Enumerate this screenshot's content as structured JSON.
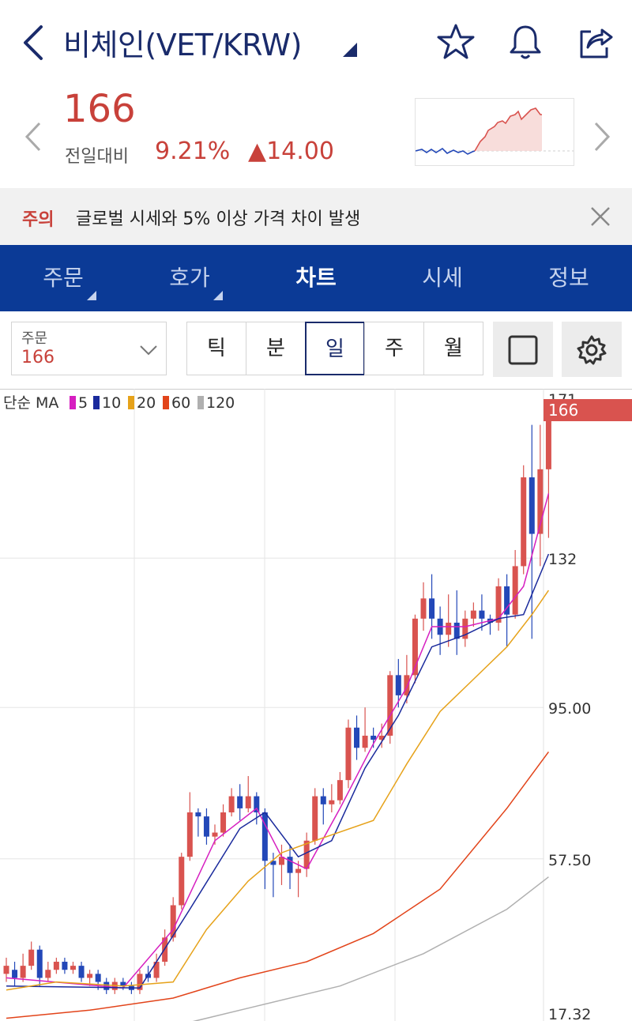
{
  "header": {
    "title": "비체인(VET/KRW)",
    "icons": [
      "back-icon",
      "caret-down-icon",
      "star-icon",
      "bell-icon",
      "share-icon"
    ]
  },
  "price": {
    "value": "166",
    "change_label": "전일대비",
    "change_pct": "9.21%",
    "change_abs": "▲14.00",
    "up_color": "#c8413a"
  },
  "alert": {
    "tag": "주의",
    "message": "글로벌 시세와 5% 이상 가격 차이 발생"
  },
  "tabs": [
    {
      "label": "주문",
      "active": false,
      "has_menu": true
    },
    {
      "label": "호가",
      "active": false,
      "has_menu": true
    },
    {
      "label": "차트",
      "active": true,
      "has_menu": false
    },
    {
      "label": "시세",
      "active": false,
      "has_menu": false
    },
    {
      "label": "정보",
      "active": false,
      "has_menu": false
    }
  ],
  "toolbar": {
    "order_label": "주문",
    "order_value": "166",
    "intervals": [
      {
        "label": "틱",
        "active": false
      },
      {
        "label": "분",
        "active": false
      },
      {
        "label": "일",
        "active": true
      },
      {
        "label": "주",
        "active": false
      },
      {
        "label": "월",
        "active": false
      }
    ]
  },
  "theme": {
    "navy": "#0b3a96",
    "title_navy": "#1a2b6b",
    "up": "#d9534f",
    "down": "#2348b8"
  },
  "chart_data": {
    "type": "candlestick",
    "legend_prefix": "단순 MA",
    "legend": [
      {
        "name": "5",
        "color": "#d61fc0"
      },
      {
        "name": "10",
        "color": "#1a2a9c"
      },
      {
        "name": "20",
        "color": "#e6a21a"
      },
      {
        "name": "60",
        "color": "#e2441a"
      },
      {
        "name": "120",
        "color": "#b0b0b0"
      }
    ],
    "y_ticks": [
      "171",
      "132",
      "95.00",
      "57.50",
      "17.32"
    ],
    "ylim": [
      17.32,
      171
    ],
    "current_price_label": "166",
    "candles": [
      [
        29,
        31,
        27,
        33
      ],
      [
        30,
        28,
        26,
        32
      ],
      [
        28,
        31,
        27,
        34
      ],
      [
        31,
        35,
        30,
        37
      ],
      [
        35,
        28,
        26,
        36
      ],
      [
        28,
        30,
        27,
        32
      ],
      [
        30,
        32,
        29,
        33
      ],
      [
        32,
        30,
        29,
        33
      ],
      [
        30,
        31,
        29,
        32
      ],
      [
        31,
        28,
        27,
        32
      ],
      [
        28,
        29,
        26,
        30
      ],
      [
        29,
        27,
        25,
        30
      ],
      [
        27,
        25,
        24,
        28
      ],
      [
        25,
        27,
        24,
        28
      ],
      [
        27,
        26,
        25,
        28
      ],
      [
        26,
        25,
        24,
        27
      ],
      [
        25,
        29,
        24,
        30
      ],
      [
        29,
        28,
        27,
        31
      ],
      [
        28,
        32,
        27,
        34
      ],
      [
        32,
        38,
        31,
        40
      ],
      [
        38,
        46,
        37,
        48
      ],
      [
        46,
        58,
        45,
        59
      ],
      [
        58,
        69,
        57,
        74
      ],
      [
        69,
        68,
        63,
        70
      ],
      [
        68,
        63,
        61,
        70
      ],
      [
        63,
        64,
        61,
        66
      ],
      [
        64,
        69,
        63,
        71
      ],
      [
        69,
        73,
        68,
        75
      ],
      [
        73,
        70,
        67,
        76
      ],
      [
        70,
        73,
        69,
        78
      ],
      [
        73,
        69,
        66,
        74
      ],
      [
        69,
        57,
        50,
        70
      ],
      [
        57,
        56,
        48,
        59
      ],
      [
        56,
        58,
        51,
        61
      ],
      [
        58,
        54,
        50,
        61
      ],
      [
        54,
        55,
        48,
        57
      ],
      [
        55,
        62,
        53,
        64
      ],
      [
        62,
        73,
        61,
        75
      ],
      [
        73,
        71,
        66,
        75
      ],
      [
        71,
        72,
        69,
        76
      ],
      [
        72,
        77,
        71,
        79
      ],
      [
        77,
        90,
        75,
        92
      ],
      [
        90,
        85,
        82,
        93
      ],
      [
        85,
        88,
        84,
        95
      ],
      [
        88,
        87,
        85,
        90
      ],
      [
        87,
        88,
        85,
        91
      ],
      [
        88,
        103,
        86,
        104
      ],
      [
        103,
        98,
        95,
        107
      ],
      [
        98,
        103,
        96,
        108
      ],
      [
        103,
        117,
        101,
        118
      ],
      [
        117,
        122,
        114,
        126
      ],
      [
        122,
        117,
        112,
        128
      ],
      [
        117,
        113,
        108,
        120
      ],
      [
        113,
        116,
        110,
        123
      ],
      [
        116,
        112,
        108,
        124
      ],
      [
        112,
        117,
        110,
        119
      ],
      [
        117,
        119,
        115,
        121
      ],
      [
        119,
        117,
        114,
        123
      ],
      [
        117,
        116,
        113,
        118
      ],
      [
        116,
        125,
        114,
        127
      ],
      [
        125,
        118,
        110,
        128
      ],
      [
        118,
        130,
        117,
        134
      ],
      [
        130,
        152,
        128,
        155
      ],
      [
        152,
        138,
        112,
        165
      ],
      [
        138,
        154,
        130,
        165
      ],
      [
        154,
        166,
        137,
        171
      ]
    ],
    "ma": {
      "5": [
        [
          0,
          28
        ],
        [
          14,
          25.5
        ],
        [
          20,
          40
        ],
        [
          25,
          62
        ],
        [
          30,
          70
        ],
        [
          33,
          58
        ],
        [
          36,
          55
        ],
        [
          40,
          70
        ],
        [
          44,
          86
        ],
        [
          48,
          100
        ],
        [
          51,
          115
        ],
        [
          55,
          115
        ],
        [
          59,
          117
        ],
        [
          62,
          125
        ],
        [
          65,
          148
        ]
      ],
      "10": [
        [
          0,
          26
        ],
        [
          16,
          25.5
        ],
        [
          22,
          45
        ],
        [
          28,
          65
        ],
        [
          31,
          69
        ],
        [
          35,
          58
        ],
        [
          39,
          62
        ],
        [
          43,
          80
        ],
        [
          47,
          93
        ],
        [
          51,
          110
        ],
        [
          55,
          113
        ],
        [
          59,
          117
        ],
        [
          62,
          118
        ],
        [
          65,
          133
        ]
      ],
      "20": [
        [
          0,
          25
        ],
        [
          6,
          27
        ],
        [
          14,
          26
        ],
        [
          20,
          27
        ],
        [
          24,
          40
        ],
        [
          29,
          52
        ],
        [
          33,
          59
        ],
        [
          37,
          62
        ],
        [
          44,
          67
        ],
        [
          48,
          81
        ],
        [
          52,
          94
        ],
        [
          56,
          102
        ],
        [
          60,
          110
        ],
        [
          63,
          118
        ],
        [
          65,
          124
        ]
      ],
      "60": [
        [
          0,
          18
        ],
        [
          10,
          20
        ],
        [
          20,
          23
        ],
        [
          28,
          28
        ],
        [
          36,
          32
        ],
        [
          44,
          39
        ],
        [
          52,
          50
        ],
        [
          60,
          70
        ],
        [
          65,
          84
        ]
      ],
      "120": [
        [
          0,
          12
        ],
        [
          8,
          13
        ],
        [
          20,
          16
        ],
        [
          30,
          21
        ],
        [
          40,
          26
        ],
        [
          50,
          34
        ],
        [
          60,
          45
        ],
        [
          65,
          53
        ]
      ]
    }
  }
}
